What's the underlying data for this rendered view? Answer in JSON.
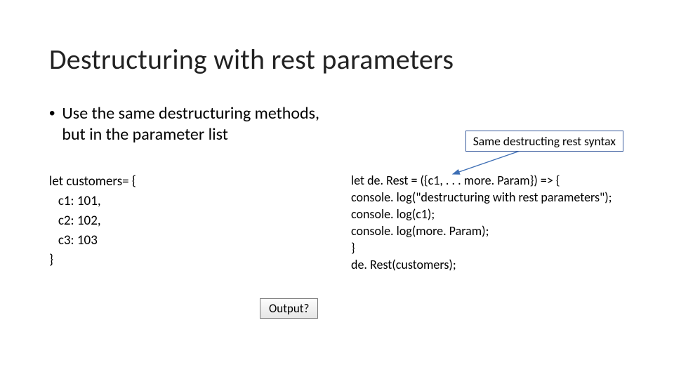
{
  "title": "Destructuring with rest parameters",
  "bullet": {
    "marker": "•",
    "text": "Use the same destructuring methods, but in the parameter list"
  },
  "callout": "Same destructing rest syntax",
  "codeLeft": "let customers= {\n   c1: 101,\n   c2: 102,\n   c3: 103\n}",
  "codeRight": "let de. Rest = ({c1, . . . more. Param}) => {\nconsole. log(\"destructuring with rest parameters\");\nconsole. log(c1);\nconsole. log(more. Param);\n}\nde. Rest(customers);",
  "outputLabel": "Output?"
}
